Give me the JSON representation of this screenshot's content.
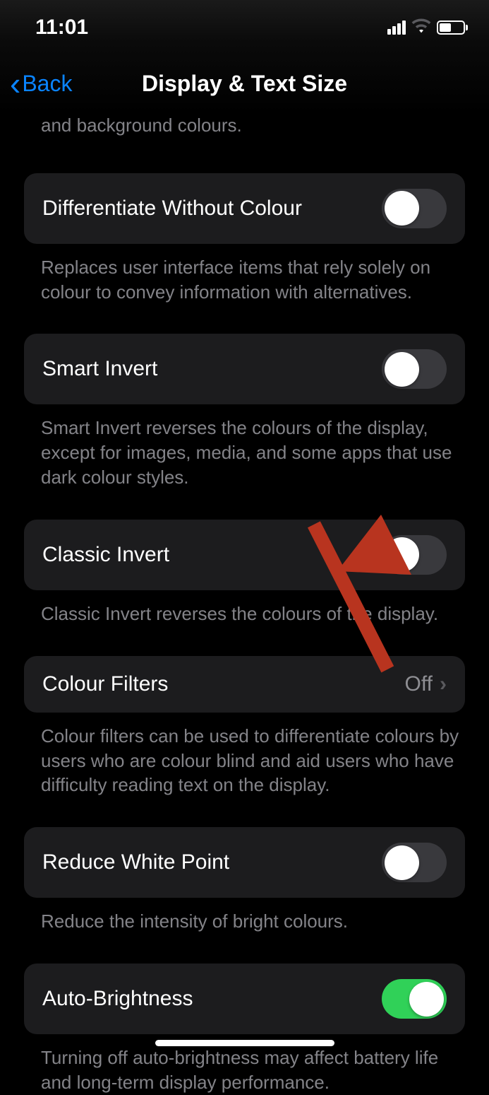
{
  "statusBar": {
    "time": "11:01"
  },
  "nav": {
    "back": "Back",
    "title": "Display & Text Size"
  },
  "partialFooter": "and background colours.",
  "groups": [
    {
      "label": "Differentiate Without Colour",
      "footer": "Replaces user interface items that rely solely on colour to convey information with alternatives.",
      "toggle": false
    },
    {
      "label": "Smart Invert",
      "footer": "Smart Invert reverses the colours of the display, except for images, media, and some apps that use dark colour styles.",
      "toggle": false
    },
    {
      "label": "Classic Invert",
      "footer": "Classic Invert reverses the colours of the display.",
      "toggle": false
    },
    {
      "label": "Colour Filters",
      "footer": "Colour filters can be used to differentiate colours by users who are colour blind and aid users who have difficulty reading text on the display.",
      "value": "Off",
      "nav": true
    },
    {
      "label": "Reduce White Point",
      "footer": "Reduce the intensity of bright colours.",
      "toggle": false
    },
    {
      "label": "Auto-Brightness",
      "footer": "Turning off auto-brightness may affect battery life and long-term display performance.",
      "toggle": true
    }
  ]
}
